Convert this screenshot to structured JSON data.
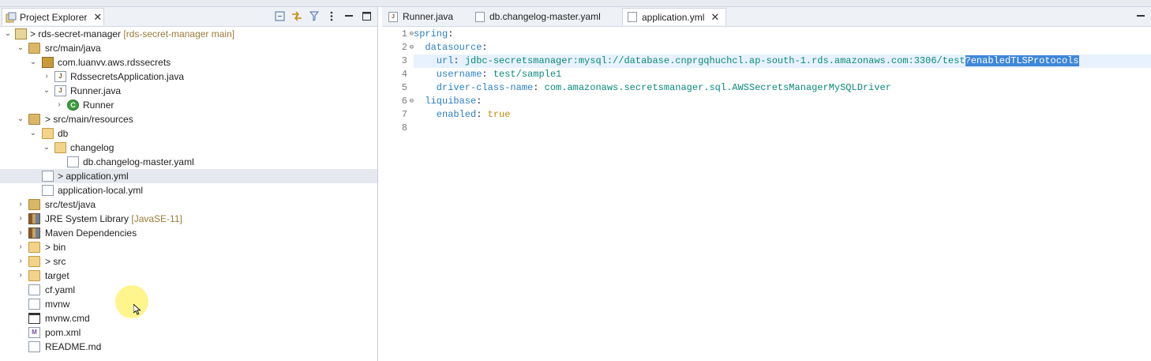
{
  "project_explorer": {
    "title": "Project Explorer",
    "items": [
      {
        "label": "> rds-secret-manager",
        "decoration": " [rds-secret-manager main]"
      },
      {
        "label": "src/main/java"
      },
      {
        "label": "com.luanvv.aws.rdssecrets"
      },
      {
        "label": "RdssecretsApplication.java"
      },
      {
        "label": "Runner.java"
      },
      {
        "label": "Runner"
      },
      {
        "label": "> src/main/resources"
      },
      {
        "label": "db"
      },
      {
        "label": "changelog"
      },
      {
        "label": "db.changelog-master.yaml"
      },
      {
        "label": "> application.yml"
      },
      {
        "label": "application-local.yml"
      },
      {
        "label": "src/test/java"
      },
      {
        "label": "JRE System Library",
        "decoration": " [JavaSE-11]"
      },
      {
        "label": "Maven Dependencies"
      },
      {
        "label": "> bin"
      },
      {
        "label": "> src"
      },
      {
        "label": "target"
      },
      {
        "label": "cf.yaml"
      },
      {
        "label": "mvnw"
      },
      {
        "label": "mvnw.cmd"
      },
      {
        "label": "pom.xml"
      },
      {
        "label": "README.md"
      }
    ]
  },
  "editor": {
    "tabs": [
      {
        "label": "Runner.java"
      },
      {
        "label": "db.changelog-master.yaml"
      },
      {
        "label": "application.yml"
      }
    ],
    "lines": [
      {
        "num": "1",
        "key": "spring",
        "sep": ":",
        "value": ""
      },
      {
        "num": "2",
        "key": "  datasource",
        "sep": ":",
        "value": ""
      },
      {
        "num": "3",
        "key": "    url",
        "sep": ": ",
        "value": "jdbc-secretsmanager:mysql://database.cnprgqhuchcl.ap-south-1.rds.amazonaws.com:3306/test",
        "selected": "?enabledTLSProtocols"
      },
      {
        "num": "4",
        "key": "    username",
        "sep": ": ",
        "value": "test/sample1"
      },
      {
        "num": "5",
        "key": "    driver-class-name",
        "sep": ": ",
        "value": "com.amazonaws.secretsmanager.sql.AWSSecretsManagerMySQLDriver"
      },
      {
        "num": "6",
        "key": "  liquibase",
        "sep": ":",
        "value": ""
      },
      {
        "num": "7",
        "key": "    enabled",
        "sep": ": ",
        "value": "true"
      },
      {
        "num": "8",
        "key": "",
        "sep": "",
        "value": ""
      }
    ]
  }
}
